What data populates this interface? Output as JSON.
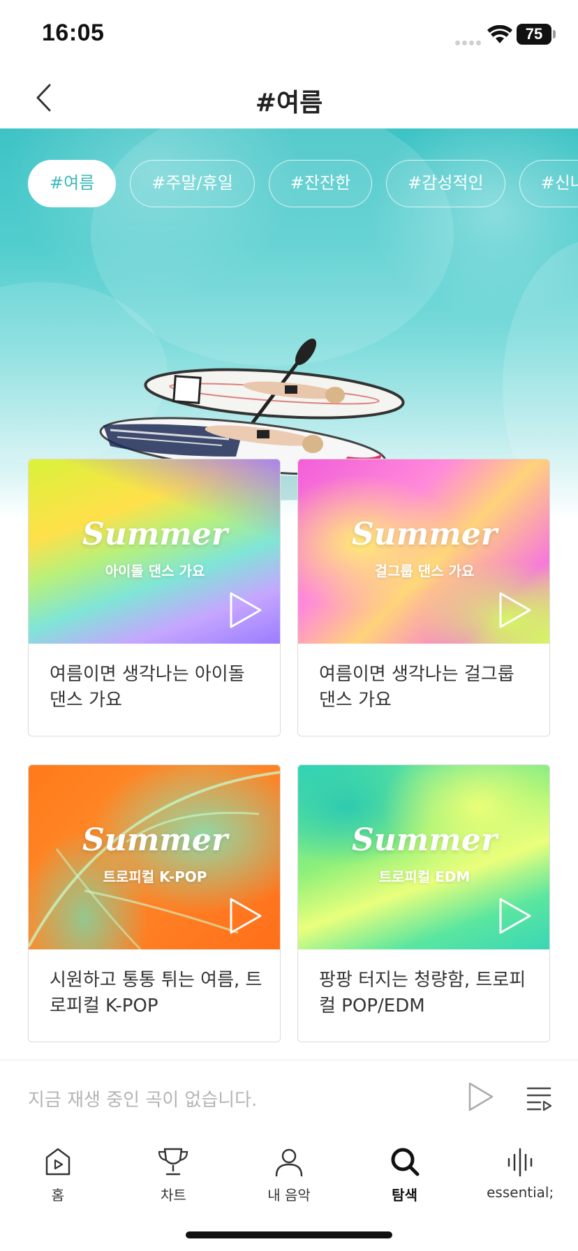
{
  "status": {
    "time": "16:05",
    "battery": "75"
  },
  "header": {
    "title": "#여름",
    "back_icon": "chevron-left-icon"
  },
  "tags": [
    "#여름",
    "#주말/휴일",
    "#잔잔한",
    "#감성적인",
    "#신나는"
  ],
  "active_tag": "#여름",
  "playlists": [
    {
      "thumb_word": "Summer",
      "thumb_sub": "아이돌 댄스 가요",
      "title": "여름이면 생각나는 아이돌 댄스 가요"
    },
    {
      "thumb_word": "Summer",
      "thumb_sub": "걸그룹 댄스 가요",
      "title": "여름이면 생각나는 걸그룹 댄스 가요"
    },
    {
      "thumb_word": "Summer",
      "thumb_sub": "트로피컬 K-POP",
      "title": "시원하고 통통 튀는 여름, 트로피컬 K-POP"
    },
    {
      "thumb_word": "Summer",
      "thumb_sub": "트로피컬 EDM",
      "title": "팡팡 터지는 청량함, 트로피컬 POP/EDM"
    }
  ],
  "mini_player": {
    "text": "지금 재생 중인 곡이 없습니다."
  },
  "nav": [
    {
      "label": "홈",
      "icon": "home-play-icon"
    },
    {
      "label": "차트",
      "icon": "trophy-icon"
    },
    {
      "label": "내 음악",
      "icon": "person-icon"
    },
    {
      "label": "탐색",
      "icon": "search-icon",
      "active": true
    },
    {
      "label": "essential;",
      "icon": "waveform-icon"
    }
  ],
  "colors": {
    "accent": "#3bb8b8",
    "hero": "#4ec9ca",
    "text": "#222222",
    "muted": "#b4b4b4"
  }
}
